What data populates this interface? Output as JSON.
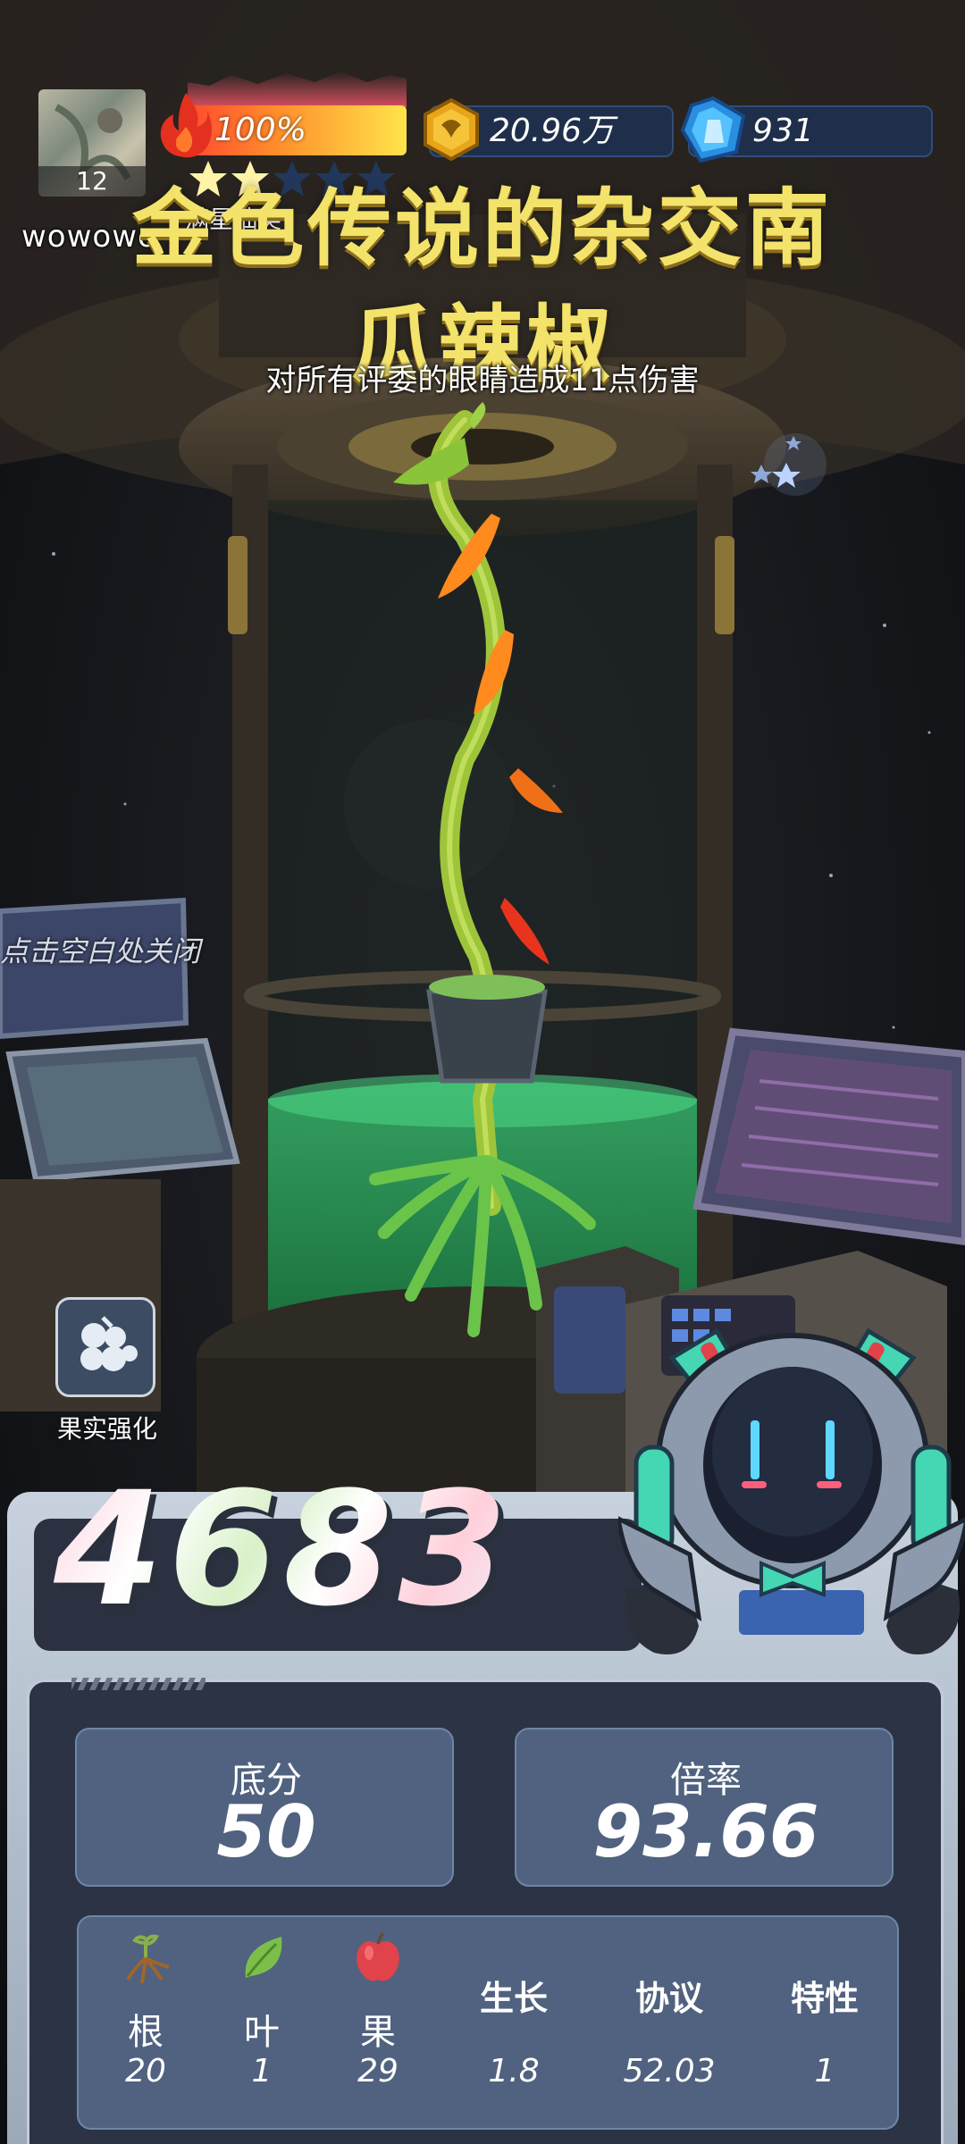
{
  "player": {
    "level": "12",
    "name": "wowowo"
  },
  "hud": {
    "energy_percent": "100%",
    "energy_fill": 1.0,
    "coins": "20.96万",
    "gems": "931",
    "lottery_label": "满星抽奖",
    "lottery_stars_filled": 2,
    "lottery_stars_total": 5
  },
  "result": {
    "title_line1": "金色传说的杂交南",
    "title_line2": "瓜辣椒",
    "effect": "对所有评委的眼睛造成11点伤害"
  },
  "close_hint": "点击空白处关闭",
  "fruit_upgrade": {
    "label": "果实强化"
  },
  "score": {
    "total": "4683",
    "base_label": "底分",
    "base_value": "50",
    "multiplier_label": "倍率",
    "multiplier_value": "93.66"
  },
  "breakdown": [
    {
      "label": "根",
      "value": "20",
      "icon": "root-icon"
    },
    {
      "label": "叶",
      "value": "1",
      "icon": "leaf-icon"
    },
    {
      "label": "果",
      "value": "29",
      "icon": "apple-icon"
    },
    {
      "label": "生长",
      "value": "1.8"
    },
    {
      "label": "协议",
      "value": "52.03"
    },
    {
      "label": "特性",
      "value": "1"
    }
  ],
  "colors": {
    "title": "#f3e36b",
    "panel_bg": "#2c3344",
    "stat_box": "#50627f",
    "pill": "#1e304e"
  }
}
